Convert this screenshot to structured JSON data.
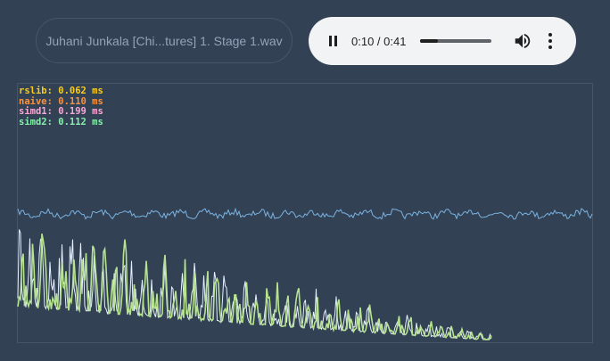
{
  "file": {
    "name": "Juhani Junkala [Chi...tures] 1. Stage 1.wav"
  },
  "player": {
    "current_time": "0:10",
    "duration": "0:41",
    "time_display": "0:10 / 0:41",
    "progress": 0.2439,
    "state": "playing",
    "play_icon": "pause-icon",
    "volume_icon": "volume-icon",
    "menu_icon": "more-vertical-icon"
  },
  "benchmarks": [
    {
      "label": "rslib: 0.062 ms",
      "color": "#facc15"
    },
    {
      "label": "naive: 0.110 ms",
      "color": "#fb923c"
    },
    {
      "label": "simd1: 0.199 ms",
      "color": "#f9a8d4"
    },
    {
      "label": "simd2: 0.112 ms",
      "color": "#86efac"
    }
  ],
  "colors": {
    "background": "#334155",
    "waveform": "#7ab3e0",
    "spectrum": "#b6e38f",
    "spectrum_alt": "#e6f0ff"
  }
}
